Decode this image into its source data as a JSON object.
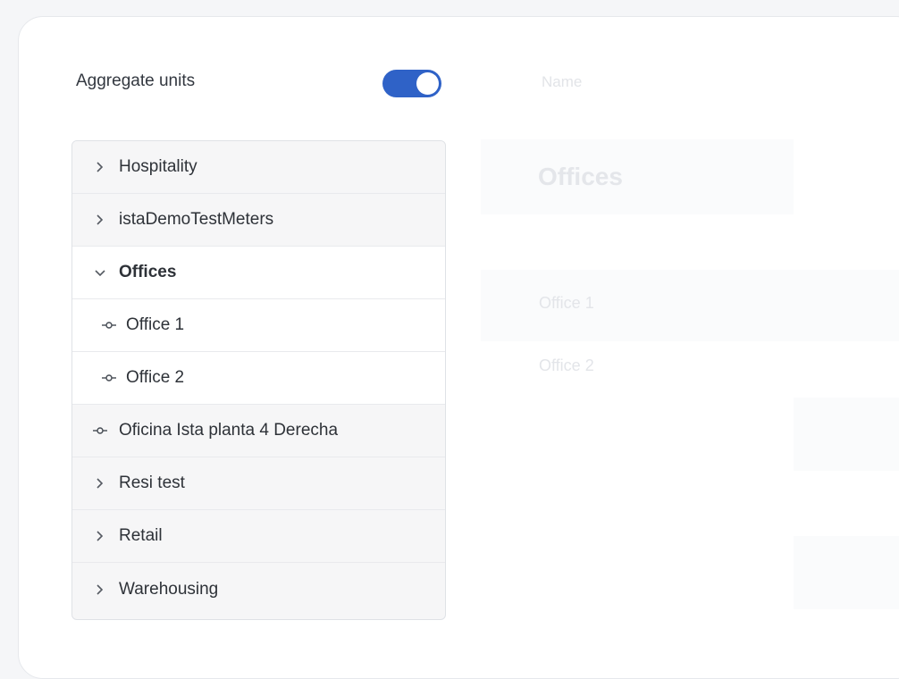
{
  "aggregate": {
    "label": "Aggregate units",
    "enabled": true
  },
  "table": {
    "header_name": "Name"
  },
  "tree": [
    {
      "label": "Hospitality",
      "icon": "chevron-right-icon",
      "state": "collapsed"
    },
    {
      "label": "istaDemoTestMeters",
      "icon": "chevron-right-icon",
      "state": "collapsed"
    },
    {
      "label": "Offices",
      "icon": "chevron-down-icon",
      "state": "expanded"
    },
    {
      "label": "Office 1",
      "icon": "unit-node-icon",
      "state": "leaf"
    },
    {
      "label": "Office 2",
      "icon": "unit-node-icon",
      "state": "leaf"
    },
    {
      "label": "Oficina Ista planta 4 Derecha",
      "icon": "unit-node-icon",
      "state": "leaf"
    },
    {
      "label": "Resi test",
      "icon": "chevron-right-icon",
      "state": "collapsed"
    },
    {
      "label": "Retail",
      "icon": "chevron-right-icon",
      "state": "collapsed"
    },
    {
      "label": "Warehousing",
      "icon": "chevron-right-icon",
      "state": "collapsed"
    }
  ],
  "detail": {
    "group_title": "Offices",
    "items": [
      "Office 1",
      "Office 2"
    ]
  },
  "colors": {
    "accent": "#2f62c7",
    "tree_bg": "#f6f6f7",
    "selected_bg": "#ffffff"
  }
}
